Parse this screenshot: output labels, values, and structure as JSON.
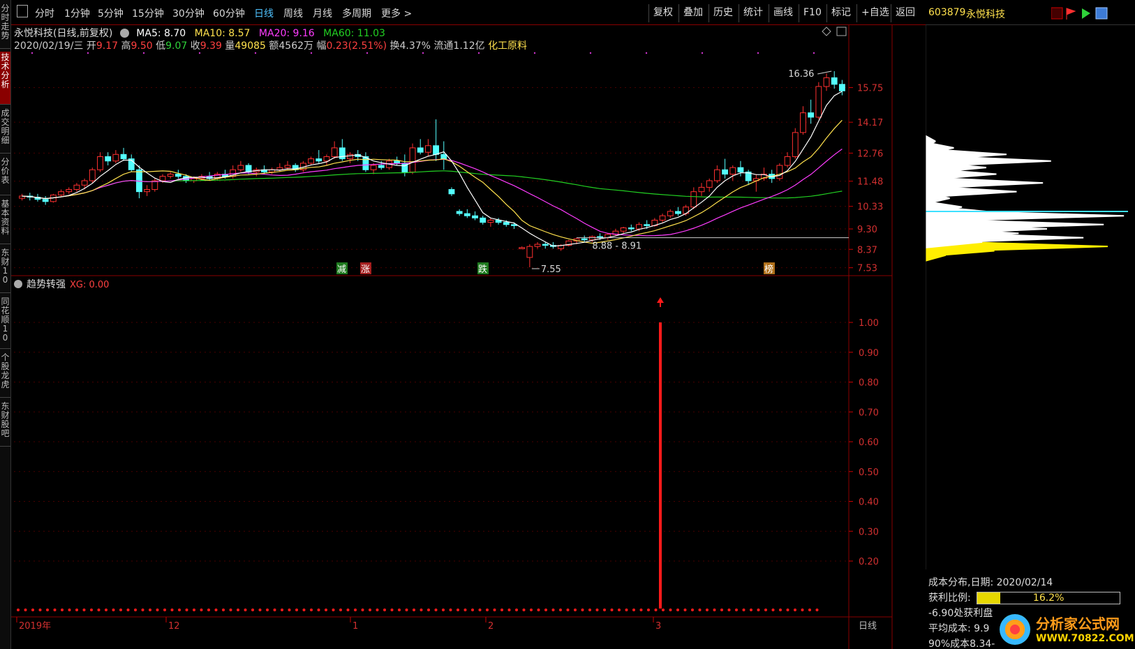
{
  "left_tabs": [
    {
      "label": "分时走势",
      "active": false
    },
    {
      "label": "技术分析",
      "active": true
    },
    {
      "label": "成交明细",
      "active": false
    },
    {
      "label": "分价表",
      "active": false
    },
    {
      "label": "基本资料",
      "active": false
    },
    {
      "label": "东财10",
      "active": false
    },
    {
      "label": "同花顺10",
      "active": false
    },
    {
      "label": "个股龙虎",
      "active": false
    },
    {
      "label": "东财股吧",
      "active": false
    }
  ],
  "toolbar": {
    "periods": [
      "分时",
      "1分钟",
      "5分钟",
      "15分钟",
      "30分钟",
      "60分钟",
      "日线",
      "周线",
      "月线",
      "多周期",
      "更多 >"
    ],
    "active_period": "日线",
    "actions": [
      "复权",
      "叠加",
      "历史",
      "统计",
      "画线",
      "F10",
      "标记",
      "+自选",
      "返回"
    ]
  },
  "stock": {
    "code": "603879",
    "name": "永悦科技"
  },
  "ma_legend": {
    "title": "永悦科技(日线,前复权)",
    "items": [
      {
        "label": "MA5: 8.70",
        "color": "#ffffff"
      },
      {
        "label": "MA10: 8.57",
        "color": "#ffe14d"
      },
      {
        "label": "MA20: 9.16",
        "color": "#ff3cff"
      },
      {
        "label": "MA60: 11.03",
        "color": "#22d022"
      }
    ]
  },
  "quote_line": {
    "date": "2020/02/19/三",
    "open_label": "开",
    "open": "9.17",
    "high_label": "高",
    "high": "9.50",
    "low_label": "低",
    "low": "9.07",
    "close_label": "收",
    "close": "9.39",
    "volume_label": "量",
    "volume": "49085",
    "amount_label": "额",
    "amount": "4562万",
    "change_label": "幅",
    "change": "0.23(2.51%)",
    "turnover": "换4.37%",
    "float_cap": "流通1.12亿",
    "sector": "化工原料"
  },
  "price_axis": [
    "15.75",
    "14.17",
    "12.76",
    "11.48",
    "10.33",
    "9.30",
    "8.37",
    "7.53"
  ],
  "annotations": {
    "high_marker": "16.36",
    "low_marker": "7.55",
    "support_range": "8.88 - 8.91",
    "signals": [
      {
        "text": "减",
        "bg": "#1f7a1f"
      },
      {
        "text": "涨",
        "bg": "#a51f1f"
      },
      {
        "text": "跌",
        "bg": "#1f7a1f"
      },
      {
        "text": "榜",
        "bg": "#b0701a"
      }
    ]
  },
  "indicator": {
    "name": "趋势转强",
    "value_label": "XG: 0.00",
    "axis": [
      "1.00",
      "0.90",
      "0.80",
      "0.70",
      "0.60",
      "0.50",
      "0.40",
      "0.30",
      "0.20"
    ]
  },
  "time_axis": {
    "labels": [
      "2019年",
      "12",
      "1",
      "2",
      "3"
    ],
    "period": "日线"
  },
  "chart_data": {
    "type": "candlestick",
    "title": "永悦科技(日线,前复权)",
    "ylim": [
      7.2,
      17.2
    ],
    "series": [
      {
        "name": "K线",
        "ohlc": [
          [
            10.7,
            10.9,
            10.6,
            10.8
          ],
          [
            10.8,
            10.95,
            10.6,
            10.75
          ],
          [
            10.75,
            10.9,
            10.55,
            10.65
          ],
          [
            10.65,
            10.8,
            10.4,
            10.55
          ],
          [
            10.55,
            10.9,
            10.5,
            10.85
          ],
          [
            10.85,
            11.1,
            10.8,
            11.0
          ],
          [
            11.0,
            11.2,
            10.9,
            11.1
          ],
          [
            11.1,
            11.4,
            11.0,
            11.3
          ],
          [
            11.3,
            11.6,
            11.1,
            11.5
          ],
          [
            11.5,
            12.1,
            11.4,
            12.0
          ],
          [
            12.0,
            12.8,
            11.9,
            12.6
          ],
          [
            12.6,
            12.8,
            12.2,
            12.4
          ],
          [
            12.4,
            12.9,
            12.3,
            12.7
          ],
          [
            12.7,
            13.0,
            12.4,
            12.5
          ],
          [
            12.5,
            12.7,
            11.9,
            12.0
          ],
          [
            12.0,
            12.2,
            10.7,
            11.0
          ],
          [
            11.0,
            11.3,
            10.8,
            11.1
          ],
          [
            11.1,
            11.6,
            11.0,
            11.5
          ],
          [
            11.5,
            11.8,
            11.4,
            11.7
          ],
          [
            11.7,
            11.9,
            11.6,
            11.8
          ],
          [
            11.8,
            12.0,
            11.6,
            11.7
          ],
          [
            11.7,
            11.8,
            11.4,
            11.5
          ],
          [
            11.5,
            11.7,
            11.4,
            11.6
          ],
          [
            11.6,
            11.8,
            11.5,
            11.7
          ],
          [
            11.7,
            11.9,
            11.5,
            11.6
          ],
          [
            11.6,
            11.9,
            11.5,
            11.8
          ],
          [
            11.8,
            12.0,
            11.6,
            11.7
          ],
          [
            11.7,
            12.2,
            11.6,
            12.0
          ],
          [
            12.0,
            12.4,
            11.9,
            12.2
          ],
          [
            12.2,
            12.3,
            11.8,
            11.9
          ],
          [
            11.9,
            12.1,
            11.7,
            12.0
          ],
          [
            12.0,
            12.2,
            11.8,
            11.9
          ],
          [
            11.9,
            12.1,
            11.8,
            12.0
          ],
          [
            12.0,
            12.3,
            11.9,
            12.1
          ],
          [
            12.1,
            12.4,
            12.0,
            12.2
          ],
          [
            12.2,
            12.3,
            11.9,
            12.0
          ],
          [
            12.0,
            12.4,
            11.9,
            12.3
          ],
          [
            12.3,
            12.6,
            12.2,
            12.5
          ],
          [
            12.5,
            12.9,
            12.3,
            12.4
          ],
          [
            12.4,
            12.7,
            12.2,
            12.6
          ],
          [
            12.6,
            13.3,
            12.5,
            13.0
          ],
          [
            13.0,
            13.4,
            12.4,
            12.5
          ],
          [
            12.5,
            12.8,
            12.3,
            12.7
          ],
          [
            12.7,
            12.9,
            12.4,
            12.6
          ],
          [
            12.6,
            12.8,
            11.9,
            12.0
          ],
          [
            12.0,
            12.3,
            11.8,
            12.2
          ],
          [
            12.2,
            12.4,
            12.0,
            12.1
          ],
          [
            12.1,
            12.5,
            12.0,
            12.4
          ],
          [
            12.4,
            12.6,
            12.2,
            12.3
          ],
          [
            12.3,
            12.7,
            11.7,
            11.9
          ],
          [
            11.9,
            13.2,
            11.8,
            13.0
          ],
          [
            13.0,
            13.4,
            12.7,
            12.8
          ],
          [
            12.8,
            13.4,
            12.6,
            13.1
          ],
          [
            13.1,
            14.3,
            12.4,
            12.7
          ],
          [
            12.7,
            13.3,
            12.0,
            12.5
          ],
          [
            11.1,
            11.2,
            10.8,
            10.9
          ],
          [
            10.1,
            10.2,
            9.9,
            10.0
          ],
          [
            10.0,
            10.2,
            9.8,
            9.9
          ],
          [
            9.9,
            10.1,
            9.7,
            9.8
          ],
          [
            9.8,
            9.9,
            9.5,
            9.6
          ],
          [
            9.6,
            9.8,
            9.4,
            9.7
          ],
          [
            9.7,
            9.8,
            9.5,
            9.6
          ],
          [
            9.6,
            9.7,
            9.4,
            9.5
          ],
          [
            9.5,
            9.6,
            9.3,
            9.45
          ],
          [
            8.4,
            8.5,
            8.4,
            8.45
          ],
          [
            8.0,
            8.6,
            7.55,
            8.5
          ],
          [
            8.5,
            8.7,
            8.4,
            8.6
          ],
          [
            8.6,
            8.7,
            8.4,
            8.55
          ],
          [
            8.55,
            8.7,
            8.4,
            8.5
          ],
          [
            8.4,
            8.6,
            8.3,
            8.55
          ],
          [
            8.55,
            8.8,
            8.5,
            8.75
          ],
          [
            8.75,
            8.9,
            8.6,
            8.85
          ],
          [
            8.85,
            9.0,
            8.7,
            8.8
          ],
          [
            8.8,
            9.0,
            8.7,
            8.95
          ],
          [
            8.95,
            9.1,
            8.8,
            8.9
          ],
          [
            8.9,
            9.1,
            8.8,
            9.05
          ],
          [
            9.05,
            9.3,
            9.0,
            9.2
          ],
          [
            9.2,
            9.4,
            9.1,
            9.35
          ],
          [
            9.35,
            9.5,
            9.2,
            9.3
          ],
          [
            9.3,
            9.6,
            9.2,
            9.5
          ],
          [
            9.5,
            9.7,
            9.3,
            9.45
          ],
          [
            9.45,
            9.8,
            9.4,
            9.7
          ],
          [
            9.7,
            10.0,
            9.6,
            9.9
          ],
          [
            9.9,
            10.2,
            9.8,
            10.1
          ],
          [
            10.1,
            10.3,
            9.9,
            10.0
          ],
          [
            10.0,
            10.4,
            9.9,
            10.3
          ],
          [
            10.3,
            11.2,
            10.2,
            11.0
          ],
          [
            11.0,
            11.4,
            10.8,
            11.2
          ],
          [
            11.2,
            11.6,
            11.0,
            11.5
          ],
          [
            11.5,
            12.2,
            11.4,
            12.0
          ],
          [
            12.0,
            12.5,
            11.6,
            11.8
          ],
          [
            11.8,
            12.2,
            11.5,
            12.1
          ],
          [
            12.1,
            12.4,
            11.7,
            11.9
          ],
          [
            11.9,
            12.0,
            11.3,
            11.5
          ],
          [
            11.5,
            11.8,
            11.0,
            11.6
          ],
          [
            11.6,
            12.1,
            11.5,
            11.8
          ],
          [
            11.8,
            12.0,
            11.4,
            11.6
          ],
          [
            11.6,
            12.3,
            11.5,
            12.2
          ],
          [
            12.2,
            12.8,
            12.1,
            12.6
          ],
          [
            12.6,
            13.9,
            12.5,
            13.7
          ],
          [
            13.7,
            14.9,
            13.6,
            14.6
          ],
          [
            14.6,
            15.2,
            14.1,
            14.4
          ],
          [
            14.4,
            16.0,
            14.3,
            15.8
          ],
          [
            15.8,
            16.4,
            15.6,
            16.2
          ],
          [
            16.2,
            16.5,
            15.7,
            15.9
          ],
          [
            15.9,
            16.1,
            15.4,
            15.6
          ]
        ]
      },
      {
        "name": "MA5",
        "color": "#ffffff"
      },
      {
        "name": "MA10",
        "color": "#ffe14d"
      },
      {
        "name": "MA20",
        "color": "#ff3cff"
      },
      {
        "name": "MA60",
        "color": "#22d022"
      }
    ],
    "signal_bar_index": 88,
    "signal_value": 1.0
  },
  "cost_distribution": {
    "title": "成本分布,日期: 2020/02/14",
    "profit_ratio_label": "获利比例:",
    "profit_ratio": "16.2%",
    "profit_ratio_value": 0.162,
    "profit_line": "-6.90处获利盘",
    "avg_cost": "平均成本: 9.9",
    "cost90": "90%成本8.34-",
    "avg_cost_price": 10.1,
    "bins": [
      {
        "price": 8.1,
        "w": 0.1,
        "y": true
      },
      {
        "price": 8.3,
        "w": 0.34,
        "y": true
      },
      {
        "price": 8.5,
        "w": 0.9,
        "y": true
      },
      {
        "price": 8.7,
        "w": 0.28,
        "y": false
      },
      {
        "price": 8.9,
        "w": 0.78,
        "y": false
      },
      {
        "price": 9.1,
        "w": 0.46,
        "y": false
      },
      {
        "price": 9.3,
        "w": 0.6,
        "y": false
      },
      {
        "price": 9.5,
        "w": 0.88,
        "y": false
      },
      {
        "price": 9.7,
        "w": 0.22,
        "y": false
      },
      {
        "price": 9.9,
        "w": 0.98,
        "y": false
      },
      {
        "price": 10.1,
        "w": 0.3,
        "y": false
      },
      {
        "price": 10.3,
        "w": 0.18,
        "y": false
      },
      {
        "price": 10.7,
        "w": 0.12,
        "y": false
      },
      {
        "price": 11.0,
        "w": 0.45,
        "y": false
      },
      {
        "price": 11.4,
        "w": 0.58,
        "y": false
      },
      {
        "price": 11.8,
        "w": 0.35,
        "y": false
      },
      {
        "price": 12.1,
        "w": 0.3,
        "y": false
      },
      {
        "price": 12.4,
        "w": 0.62,
        "y": false
      },
      {
        "price": 12.7,
        "w": 0.4,
        "y": false
      },
      {
        "price": 13.0,
        "w": 0.14,
        "y": false
      },
      {
        "price": 13.3,
        "w": 0.05,
        "y": false
      }
    ]
  },
  "watermark": {
    "title": "分析家公式网",
    "url": "WWW.70822.COM"
  }
}
